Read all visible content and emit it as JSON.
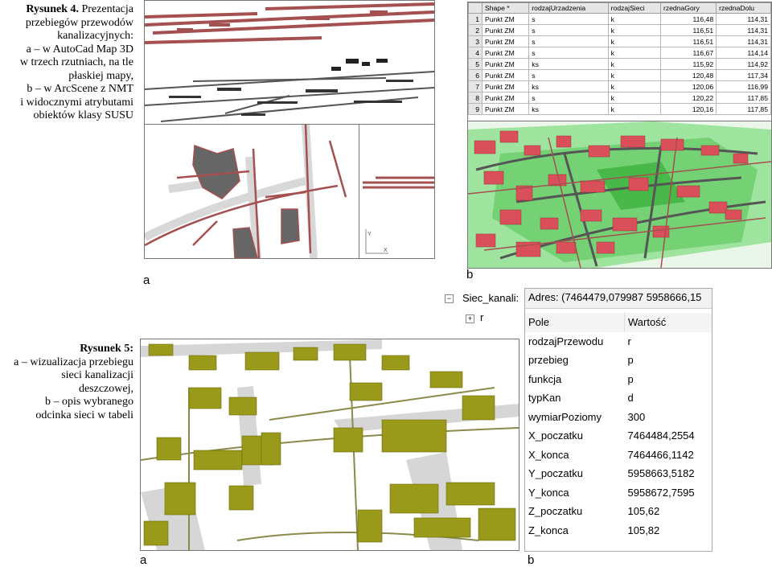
{
  "figure4": {
    "caption_label": "Rysunek 4.",
    "caption_lines": [
      "Prezentacja",
      "przebiegów przewodów",
      "kanalizacyjnych:",
      "a – w AutoCad Map 3D",
      "w trzech rzutniach, na tle",
      "płaskiej mapy,",
      "b – w ArcScene z NMT",
      "i widocznymi atrybutami",
      "obiektów klasy SUSU"
    ],
    "sublabel_a": "a",
    "sublabel_b": "b",
    "attr_table": {
      "columns": [
        "",
        "Shape *",
        "rodzajUrzadzenia",
        "rodzajSieci",
        "rzednaGory",
        "rzednaDolu"
      ],
      "rows": [
        [
          "1",
          "Punkt ZM",
          "s",
          "k",
          "116,48",
          "114,31"
        ],
        [
          "2",
          "Punkt ZM",
          "s",
          "k",
          "116,51",
          "114,31"
        ],
        [
          "3",
          "Punkt ZM",
          "s",
          "k",
          "116,51",
          "114,31"
        ],
        [
          "4",
          "Punkt ZM",
          "s",
          "k",
          "116,67",
          "114,14"
        ],
        [
          "5",
          "Punkt ZM",
          "ks",
          "k",
          "115,92",
          "114,92"
        ],
        [
          "6",
          "Punkt ZM",
          "s",
          "k",
          "120,48",
          "117,34"
        ],
        [
          "7",
          "Punkt ZM",
          "ks",
          "k",
          "120,06",
          "116,99"
        ],
        [
          "8",
          "Punkt ZM",
          "s",
          "k",
          "120,22",
          "117,85"
        ],
        [
          "9",
          "Punkt ZM",
          "ks",
          "k",
          "120,16",
          "117,85"
        ]
      ]
    }
  },
  "figure5": {
    "caption_label": "Rysunek 5:",
    "caption_lines": [
      "a – wizualizacja przebiegu",
      "sieci kanalizacji",
      "deszczowej,",
      "b – opis wybranego",
      "odcinka sieci w tabeli"
    ],
    "sublabel_a": "a",
    "sublabel_b": "b",
    "tree_root": "Siec_kanali:",
    "tree_child": "r",
    "address": "Adres: (7464479,079987 5958666,15",
    "props_header": [
      "Pole",
      "Wartość"
    ],
    "props": [
      [
        "rodzajPrzewodu",
        "r"
      ],
      [
        "przebieg",
        "p"
      ],
      [
        "funkcja",
        "p"
      ],
      [
        "typKan",
        "d"
      ],
      [
        "wymiarPoziomy",
        "300"
      ],
      [
        "X_poczatku",
        "7464484,2554"
      ],
      [
        "X_konca",
        "7464466,1142"
      ],
      [
        "Y_poczatku",
        "5958663,5182"
      ],
      [
        "Y_konca",
        "5958672,7595"
      ],
      [
        "Z_poczatku",
        "105,62"
      ],
      [
        "Z_konca",
        "105,82"
      ]
    ]
  },
  "colors": {
    "pipe_red": "#a55050",
    "building_red": "#d9505a",
    "terrain_green": "#7fd07f",
    "building_olive": "#99991a"
  }
}
